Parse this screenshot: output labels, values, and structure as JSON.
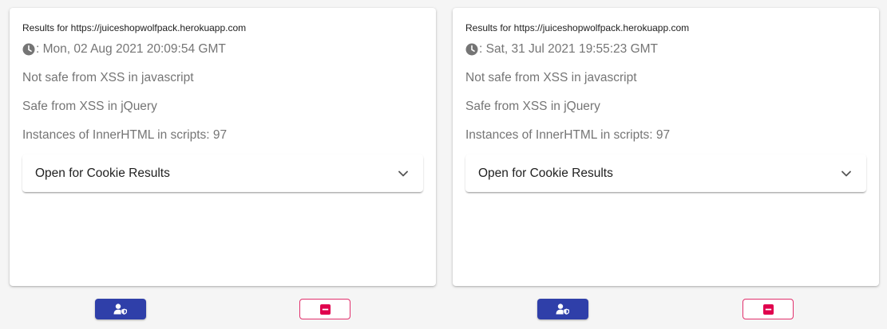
{
  "colors": {
    "primary": "#2f3fa9",
    "danger": "#e1306c",
    "text_secondary": "#757575",
    "text_primary": "#212121"
  },
  "cards": [
    {
      "results_url": "Results for https://juiceshopwolfpack.herokuapp.com",
      "timestamp": ": Mon, 02 Aug 2021 20:09:54 GMT",
      "javascript_status": "Not safe from XSS in javascript",
      "jquery_status": "Safe from XSS in jQuery",
      "innerhtml_count": "Instances of InnerHTML in scripts: 97",
      "cookie_panel_label": "Open for Cookie Results",
      "icons": {
        "timestamp": "clock-icon",
        "expand": "chevron-down-icon",
        "primary_action": "user-shield-icon",
        "delete_action": "minus-square-icon"
      }
    },
    {
      "results_url": "Results for https://juiceshopwolfpack.herokuapp.com",
      "timestamp": ": Sat, 31 Jul 2021 19:55:23 GMT",
      "javascript_status": "Not safe from XSS in javascript",
      "jquery_status": "Safe from XSS in jQuery",
      "innerhtml_count": "Instances of InnerHTML in scripts: 97",
      "cookie_panel_label": "Open for Cookie Results",
      "icons": {
        "timestamp": "clock-icon",
        "expand": "chevron-down-icon",
        "primary_action": "user-shield-icon",
        "delete_action": "minus-square-icon"
      }
    }
  ]
}
